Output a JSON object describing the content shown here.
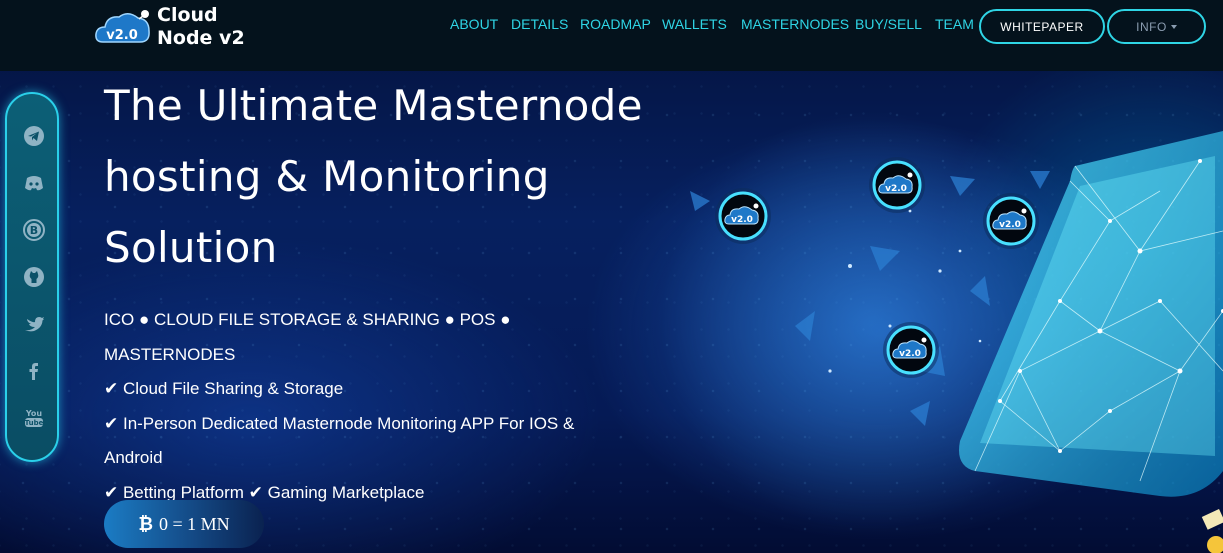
{
  "brand": {
    "line1": "Cloud",
    "line2": "Node v2",
    "logo_badge": "v2.0",
    "icon": "cloud-logo-icon"
  },
  "nav": {
    "links": [
      "ABOUT",
      "DETAILS",
      "ROADMAP",
      "WALLETS",
      "MASTERNODES",
      "BUY/SELL",
      "TEAM"
    ],
    "whitepaper_label": "WHITEPAPER",
    "info_label": "INFO"
  },
  "social": [
    {
      "name": "telegram-icon"
    },
    {
      "name": "discord-icon"
    },
    {
      "name": "bitcoin-icon"
    },
    {
      "name": "github-icon"
    },
    {
      "name": "twitter-icon"
    },
    {
      "name": "facebook-icon"
    },
    {
      "name": "youtube-icon"
    }
  ],
  "hero": {
    "title_lines": [
      "The Ultimate Masternode",
      "hosting & Monitoring",
      "Solution"
    ],
    "features": [
      "ICO ● CLOUD FILE STORAGE & SHARING ● POS ● MASTERNODES",
      "✔ Cloud File Sharing & Storage",
      "✔ In-Person Dedicated Masternode Monitoring APP For IOS &",
      "Android",
      "✔ Betting Platform ✔ Gaming Marketplace"
    ],
    "mn_label": "0 = 1 MN",
    "mn_icon": "bitcoin-icon"
  },
  "badges": [
    "v2.0",
    "v2.0",
    "v2.0",
    "v2.0"
  ],
  "colors": {
    "accent": "#2fd5e5",
    "navbar": "#04121c",
    "background": "#06205f"
  }
}
